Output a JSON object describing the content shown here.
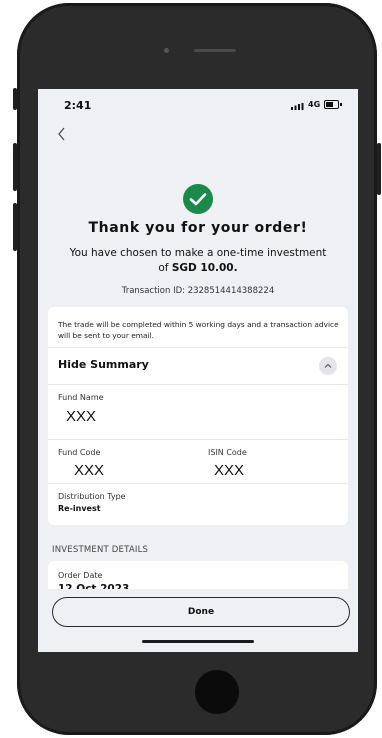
{
  "status": {
    "time": "2:41",
    "network": "4G"
  },
  "confirmation": {
    "title": "Thank you for your order!",
    "message_line1": "You have chosen to make a one-time investment",
    "message_of": "of",
    "amount": "SGD 10.00.",
    "transaction_id": "Transaction ID: 2328514414388224"
  },
  "summary": {
    "note": "The trade will be completed within 5 working days and a transaction advice will be sent to your email.",
    "toggle_label": "Hide Summary",
    "fund_name_label": "Fund Name",
    "fund_name_value": "XXX",
    "fund_code_label": "Fund Code",
    "fund_code_value": "XXX",
    "isin_label": "ISIN Code",
    "isin_value": "XXX",
    "distribution_label": "Distribution Type",
    "distribution_value": "Re-invest"
  },
  "investment_details": {
    "section_title": "INVESTMENT DETAILS",
    "order_date_label": "Order Date",
    "order_date_value": "12 Oct 2023"
  },
  "actions": {
    "done_label": "Done"
  },
  "colors": {
    "success": "#1a8a4a",
    "screen_bg": "#eef0f3",
    "button_border": "#1d2b3a"
  },
  "icons": [
    "back-chevron-icon",
    "success-check-icon",
    "chevron-up-icon",
    "signal-icon",
    "battery-icon"
  ]
}
